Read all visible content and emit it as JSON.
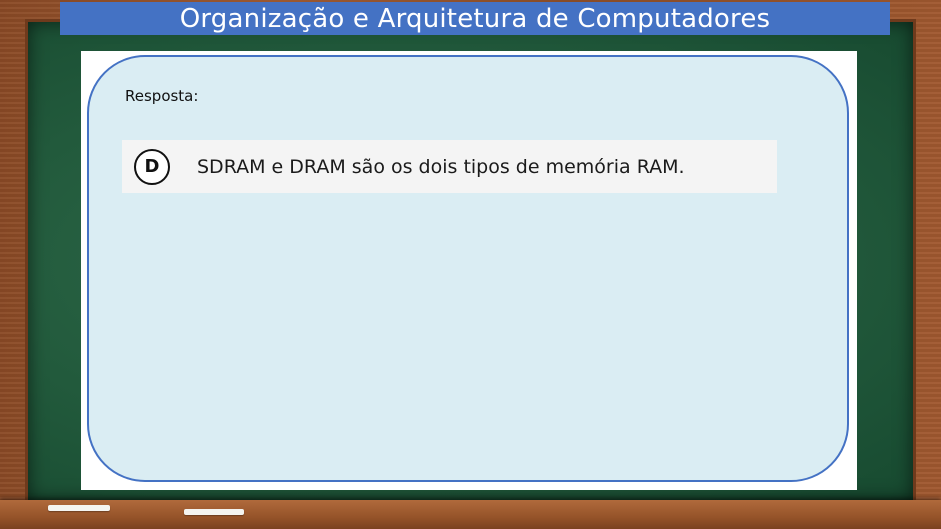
{
  "slide": {
    "title": "Organização e Arquitetura de Computadores",
    "answer_label": "Resposta:",
    "answer": {
      "letter": "D",
      "text": "SDRAM e DRAM são os dois tipos de memória RAM."
    }
  },
  "colors": {
    "title_bar": "#4472c4",
    "answer_box_fill": "#daedf3",
    "answer_box_border": "#4472c4",
    "chalkboard": "#225a3c",
    "wood_frame": "#a35d33"
  }
}
